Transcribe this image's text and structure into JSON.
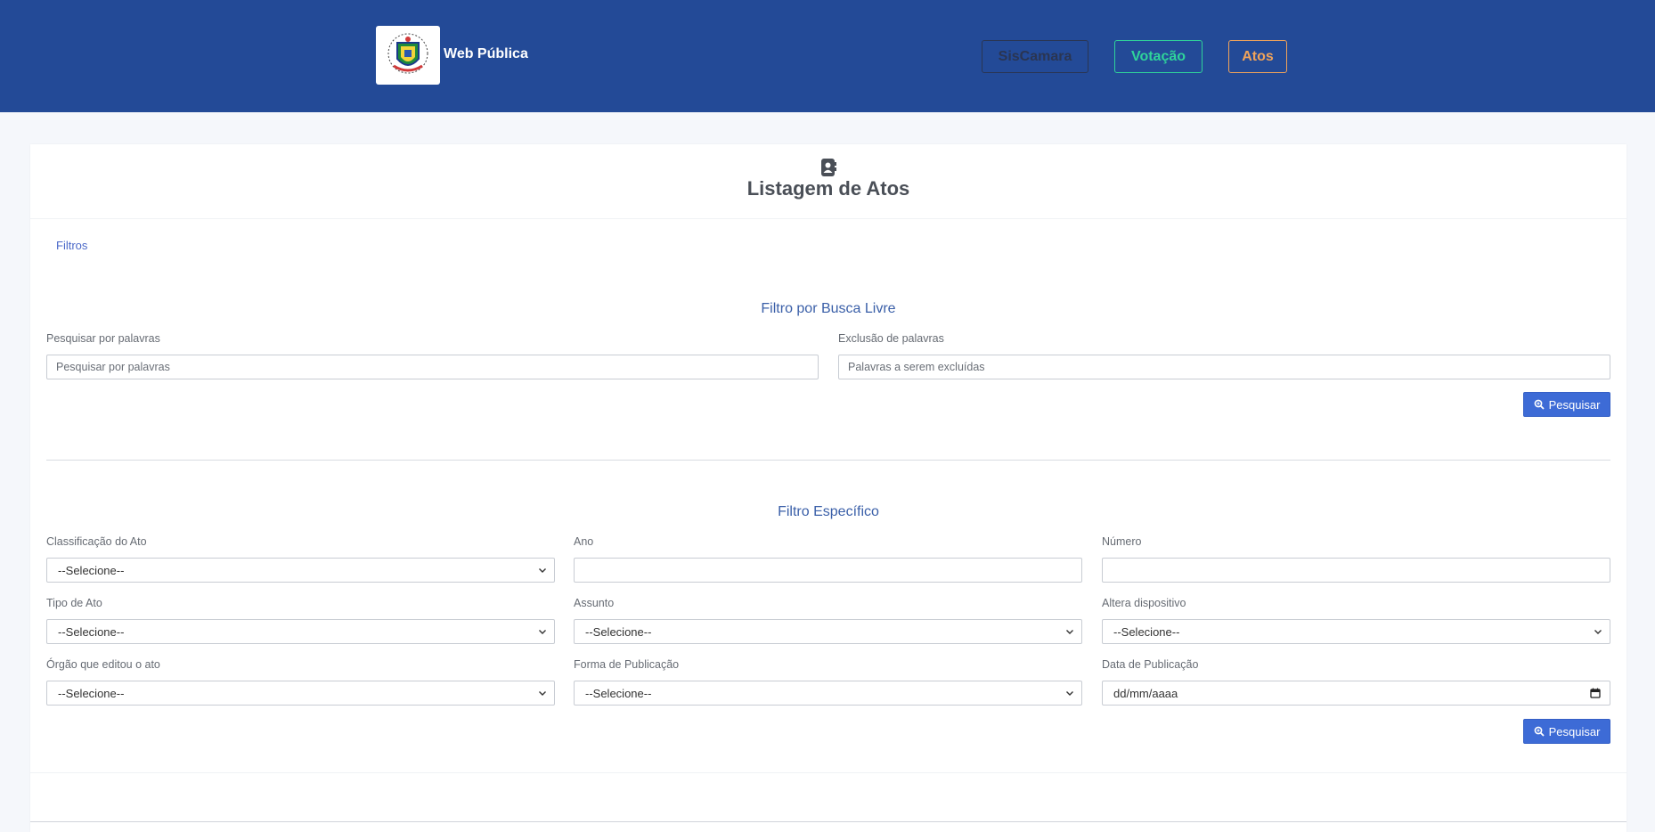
{
  "header": {
    "brand": "Web Pública",
    "nav": [
      {
        "label": "SisCamara",
        "color": "#2a3552"
      },
      {
        "label": "Votação",
        "color": "#2fd39a"
      },
      {
        "label": "Atos",
        "color": "#f0a35a"
      }
    ],
    "background": "#234a97"
  },
  "page": {
    "title": "Listagem de Atos",
    "tab": "Filtros"
  },
  "free_search": {
    "title": "Filtro por Busca Livre",
    "words_label": "Pesquisar por palavras",
    "words_placeholder": "Pesquisar por palavras",
    "exclude_label": "Exclusão de palavras",
    "exclude_placeholder": "Palavras a serem excluídas",
    "button": "Pesquisar"
  },
  "specific": {
    "title": "Filtro Específico",
    "classificacao_label": "Classificação do Ato",
    "classificacao_value": "--Selecione--",
    "ano_label": "Ano",
    "ano_value": "",
    "numero_label": "Número",
    "numero_value": "",
    "tipo_label": "Tipo de Ato",
    "tipo_value": "--Selecione--",
    "assunto_label": "Assunto",
    "assunto_value": "--Selecione--",
    "altera_label": "Altera dispositivo",
    "altera_value": "--Selecione--",
    "orgao_label": "Órgão que editou o ato",
    "orgao_value": "--Selecione--",
    "forma_label": "Forma de Publicação",
    "forma_value": "--Selecione--",
    "data_label": "Data de Publicação",
    "data_value": "dd/mm/aaaa",
    "button": "Pesquisar"
  },
  "colors": {
    "accent": "#3d6bd6",
    "section_title": "#3a5fa8"
  }
}
